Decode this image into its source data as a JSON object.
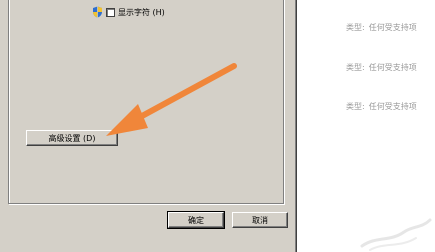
{
  "dialog": {
    "show_chars_label": "显示字符 (H)",
    "advanced_button": "高级设置 (D)",
    "ok_button": "确定",
    "cancel_button": "取消",
    "colors": {
      "face": "#d4d0c8",
      "arrow": "#f0863a"
    }
  },
  "side_info": {
    "rows": [
      {
        "label": "类型:",
        "value": "任何受支持项"
      },
      {
        "label": "类型:",
        "value": "任何受支持项"
      },
      {
        "label": "类型:",
        "value": "任何受支持项"
      }
    ]
  }
}
